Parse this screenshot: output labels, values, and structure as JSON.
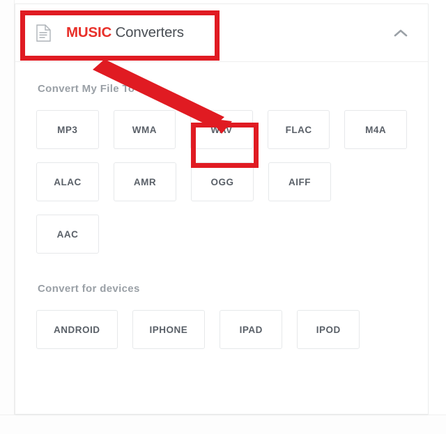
{
  "card": {
    "header": {
      "icon": "document-icon",
      "title_highlight": "MUSIC",
      "title_rest": " Converters",
      "collapse_icon": "chevron-up-icon"
    },
    "sections": [
      {
        "label": "Convert My File To",
        "rows": [
          [
            "MP3",
            "WMA",
            "WAV",
            "FLAC",
            "M4A"
          ],
          [
            "ALAC",
            "AMR",
            "OGG",
            "AIFF"
          ],
          [
            "AAC"
          ]
        ]
      },
      {
        "label": "Convert for devices",
        "rows": [
          [
            "ANDROID",
            "IPHONE",
            "IPAD",
            "IPOD"
          ]
        ]
      }
    ]
  },
  "annotations": {
    "color": "#e01b22",
    "boxes": [
      {
        "name": "header-highlight",
        "target": "MUSIC Converters"
      },
      {
        "name": "wav-highlight",
        "target": "WAV"
      }
    ],
    "arrow": {
      "from": "header-highlight",
      "to": "wav-highlight"
    }
  },
  "colors": {
    "brand_red": "#e8302a",
    "annotation_red": "#e01b22",
    "title_text": "#4a4f55",
    "section_label": "#9aa0a6",
    "button_text": "#5a6068",
    "button_border": "#e6e8ea",
    "card_border": "#eceded"
  }
}
